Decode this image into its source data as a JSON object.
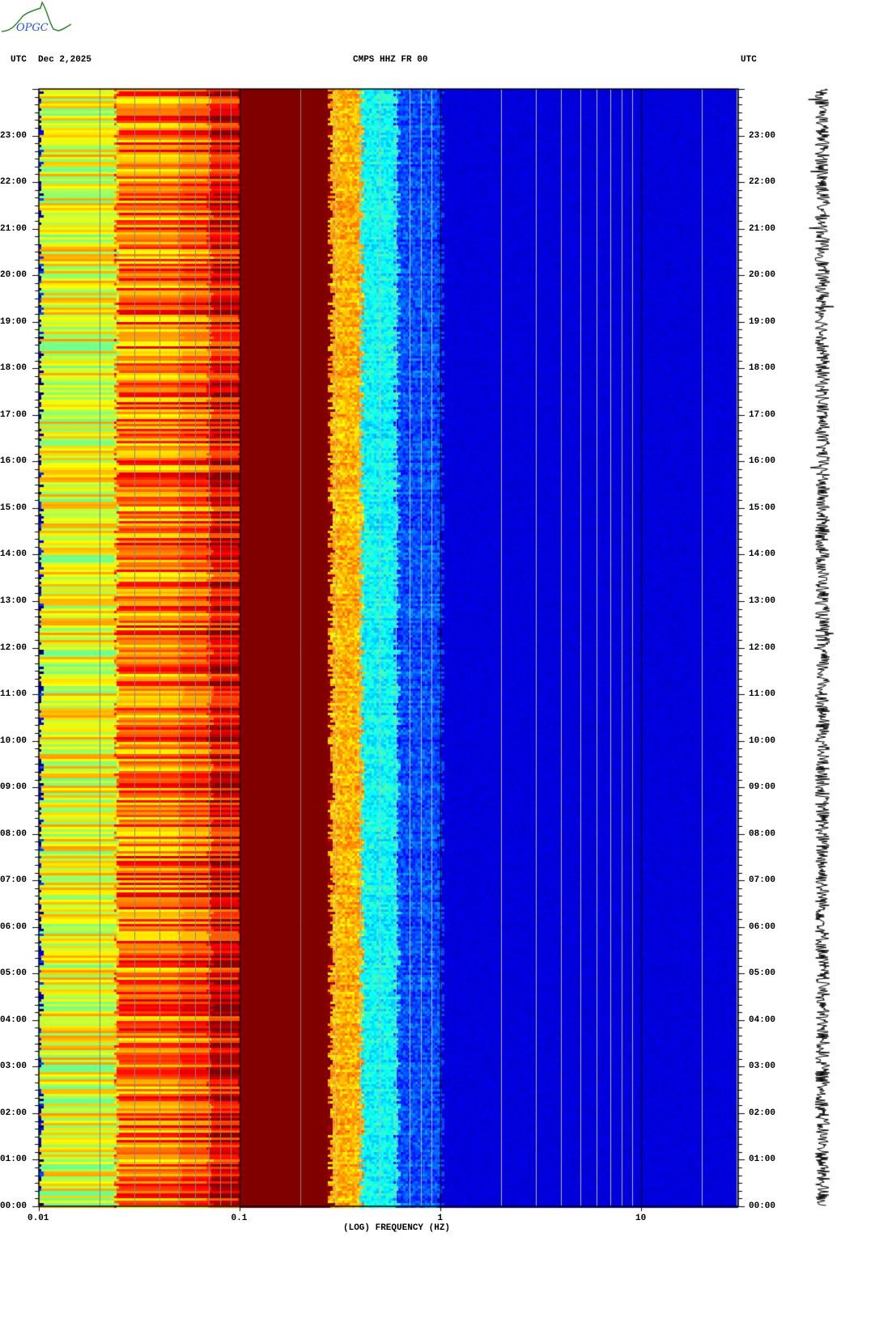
{
  "logo": {
    "text": "OPGC",
    "accent": "#2e8b2e",
    "text_color": "#2255dd"
  },
  "header": {
    "left_tz": "UTC",
    "date": "Dec 2,2025",
    "station": "CMPS HHZ FR 00",
    "right_tz": "UTC"
  },
  "chart_data": {
    "type": "heatmap",
    "title": "CMPS HHZ FR 00",
    "xlabel": "(LOG) FREQUENCY (HZ)",
    "xscale": "log",
    "xlim": [
      0.01,
      30
    ],
    "x_ticks": [
      "0.01",
      "0.1",
      "1",
      "10"
    ],
    "x_tick_values": [
      0.01,
      0.1,
      1,
      10
    ],
    "ylabel": "UTC",
    "ylim_hours": [
      0,
      24
    ],
    "y_ticks": [
      "00:00",
      "01:00",
      "02:00",
      "03:00",
      "04:00",
      "05:00",
      "06:00",
      "07:00",
      "08:00",
      "09:00",
      "10:00",
      "11:00",
      "12:00",
      "13:00",
      "14:00",
      "15:00",
      "16:00",
      "17:00",
      "18:00",
      "19:00",
      "20:00",
      "21:00",
      "22:00",
      "23:00"
    ],
    "colormap": "jet",
    "grid": true,
    "relative_power_profile": [
      {
        "f_min": 0.01,
        "f_max": 0.024,
        "level": 0.6
      },
      {
        "f_min": 0.024,
        "f_max": 0.05,
        "level": 0.76
      },
      {
        "f_min": 0.05,
        "f_max": 0.07,
        "level": 0.8
      },
      {
        "f_min": 0.07,
        "f_max": 0.1,
        "level": 0.9
      },
      {
        "f_min": 0.1,
        "f_max": 0.28,
        "level": 1.0
      },
      {
        "f_min": 0.28,
        "f_max": 0.4,
        "level": 0.7
      },
      {
        "f_min": 0.4,
        "f_max": 0.6,
        "level": 0.38
      },
      {
        "f_min": 0.6,
        "f_max": 1.0,
        "level": 0.2
      },
      {
        "f_min": 1.0,
        "f_max": 30,
        "level": 0.09
      }
    ]
  }
}
